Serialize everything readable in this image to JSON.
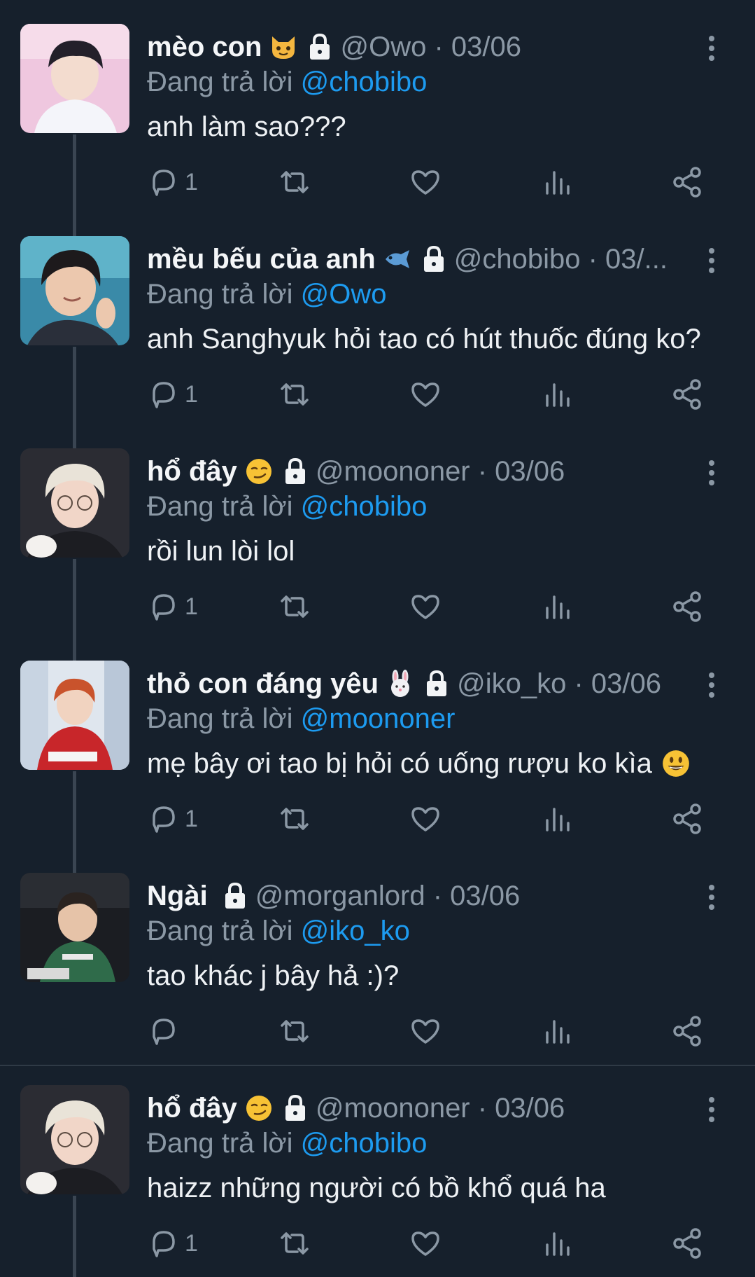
{
  "colors": {
    "background": "#16202c",
    "secondary_text": "#8b98a5",
    "mention": "#1d9bf0",
    "thread_line": "#3a4552"
  },
  "tweets": [
    {
      "name": "mèo con",
      "emoji": "cat-face-icon",
      "locked": true,
      "handle_meta": "@Owo · 03/06",
      "reply_prefix": "Đang trả lời",
      "reply_to": "@chobibo",
      "text": "anh làm sao???",
      "reply_count": "1"
    },
    {
      "name": "mều bếu của anh",
      "emoji": "fish-icon",
      "locked": true,
      "handle_meta": "@chobibo · 03/...",
      "reply_prefix": "Đang trả lời",
      "reply_to": "@Owo",
      "text": "anh Sanghyuk hỏi tao có hút thuốc đúng ko?",
      "reply_count": "1"
    },
    {
      "name": "hổ đây",
      "emoji": "smirk-face-icon",
      "locked": true,
      "handle_meta": "@moononer · 03/06",
      "reply_prefix": "Đang trả lời",
      "reply_to": "@chobibo",
      "text": "rồi lun lòi lol",
      "reply_count": "1"
    },
    {
      "name": "thỏ con đáng yêu",
      "emoji": "rabbit-face-icon",
      "locked": true,
      "handle_meta": "@iko_ko · 03/06",
      "reply_prefix": "Đang trả lời",
      "reply_to": "@moononer",
      "text": "mẹ bây ơi tao bị hỏi có uống rượu ko kìa",
      "text_emoji": "grinning-face-icon",
      "reply_count": "1"
    },
    {
      "name": "Ngài",
      "emoji": "",
      "locked": true,
      "handle_meta": "@morganlord · 03/06",
      "reply_prefix": "Đang trả lời",
      "reply_to": "@iko_ko",
      "text": "tao khác j bây hả :)?",
      "reply_count": ""
    },
    {
      "name": "hổ đây",
      "emoji": "smirk-face-icon",
      "locked": true,
      "handle_meta": "@moononer · 03/06",
      "reply_prefix": "Đang trả lời",
      "reply_to": "@chobibo",
      "text": "haizz những người có bồ khổ quá ha",
      "reply_count": "1"
    }
  ]
}
